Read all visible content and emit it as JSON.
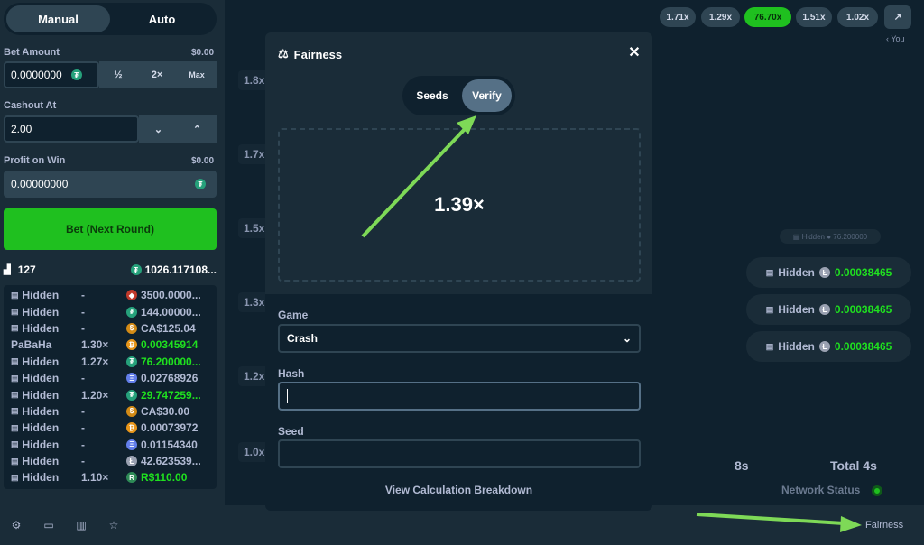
{
  "mode_tabs": {
    "manual": "Manual",
    "auto": "Auto"
  },
  "bet_amount": {
    "label": "Bet Amount",
    "usd": "$0.00",
    "value": "0.0000000",
    "half": "½",
    "double": "2×",
    "max": "Max"
  },
  "cashout": {
    "label": "Cashout At",
    "value": "2.00"
  },
  "profit": {
    "label": "Profit on Win",
    "usd": "$0.00",
    "value": "0.00000000"
  },
  "bet_button": "Bet (Next Round)",
  "players": {
    "count": "127",
    "total": "1026.117108..."
  },
  "bets": [
    {
      "user": "Hidden",
      "mult": "-",
      "coin": "trx",
      "amount": "3500.0000...",
      "win": false
    },
    {
      "user": "Hidden",
      "mult": "-",
      "coin": "usdt",
      "amount": "144.00000...",
      "win": false
    },
    {
      "user": "Hidden",
      "mult": "-",
      "coin": "cad",
      "amount": "CA$125.04",
      "win": false
    },
    {
      "user": "PaBaHa",
      "mult": "1.30×",
      "coin": "btc",
      "amount": "0.00345914",
      "win": true
    },
    {
      "user": "Hidden",
      "mult": "1.27×",
      "coin": "usdt",
      "amount": "76.200000...",
      "win": true
    },
    {
      "user": "Hidden",
      "mult": "-",
      "coin": "eth",
      "amount": "0.02768926",
      "win": false
    },
    {
      "user": "Hidden",
      "mult": "1.20×",
      "coin": "usdt",
      "amount": "29.747259...",
      "win": true
    },
    {
      "user": "Hidden",
      "mult": "-",
      "coin": "cad",
      "amount": "CA$30.00",
      "win": false
    },
    {
      "user": "Hidden",
      "mult": "-",
      "coin": "btc",
      "amount": "0.00073972",
      "win": false
    },
    {
      "user": "Hidden",
      "mult": "-",
      "coin": "eth",
      "amount": "0.01154340",
      "win": false
    },
    {
      "user": "Hidden",
      "mult": "-",
      "coin": "ltc",
      "amount": "42.623539...",
      "win": false
    },
    {
      "user": "Hidden",
      "mult": "1.10×",
      "coin": "brl",
      "amount": "R$110.00",
      "win": true
    }
  ],
  "history": [
    "1.71x",
    "1.29x",
    "76.70x",
    "1.51x",
    "1.02x"
  ],
  "history_you": "‹ You",
  "y_labels": [
    "1.8x",
    "1.7x",
    "1.5x",
    "1.3x",
    "1.2x",
    "1.0x"
  ],
  "live_cards": [
    {
      "user": "Hidden",
      "amount": "0.00038465"
    },
    {
      "user": "Hidden",
      "amount": "0.00038465"
    },
    {
      "user": "Hidden",
      "amount": "0.00038465"
    }
  ],
  "timer": "8s",
  "total": "Total 4s",
  "network_status": "Network Status",
  "fairness_link": "Fairness",
  "modal": {
    "title": "Fairness",
    "tabs": {
      "seeds": "Seeds",
      "verify": "Verify"
    },
    "result": "1.39×",
    "game_label": "Game",
    "game_value": "Crash",
    "hash_label": "Hash",
    "seed_label": "Seed",
    "calc_link": "View Calculation Breakdown"
  },
  "colors": {
    "accent": "#1fc01f",
    "arrow": "#7ed957",
    "panel": "#1a2c38",
    "bg": "#0f212e"
  }
}
